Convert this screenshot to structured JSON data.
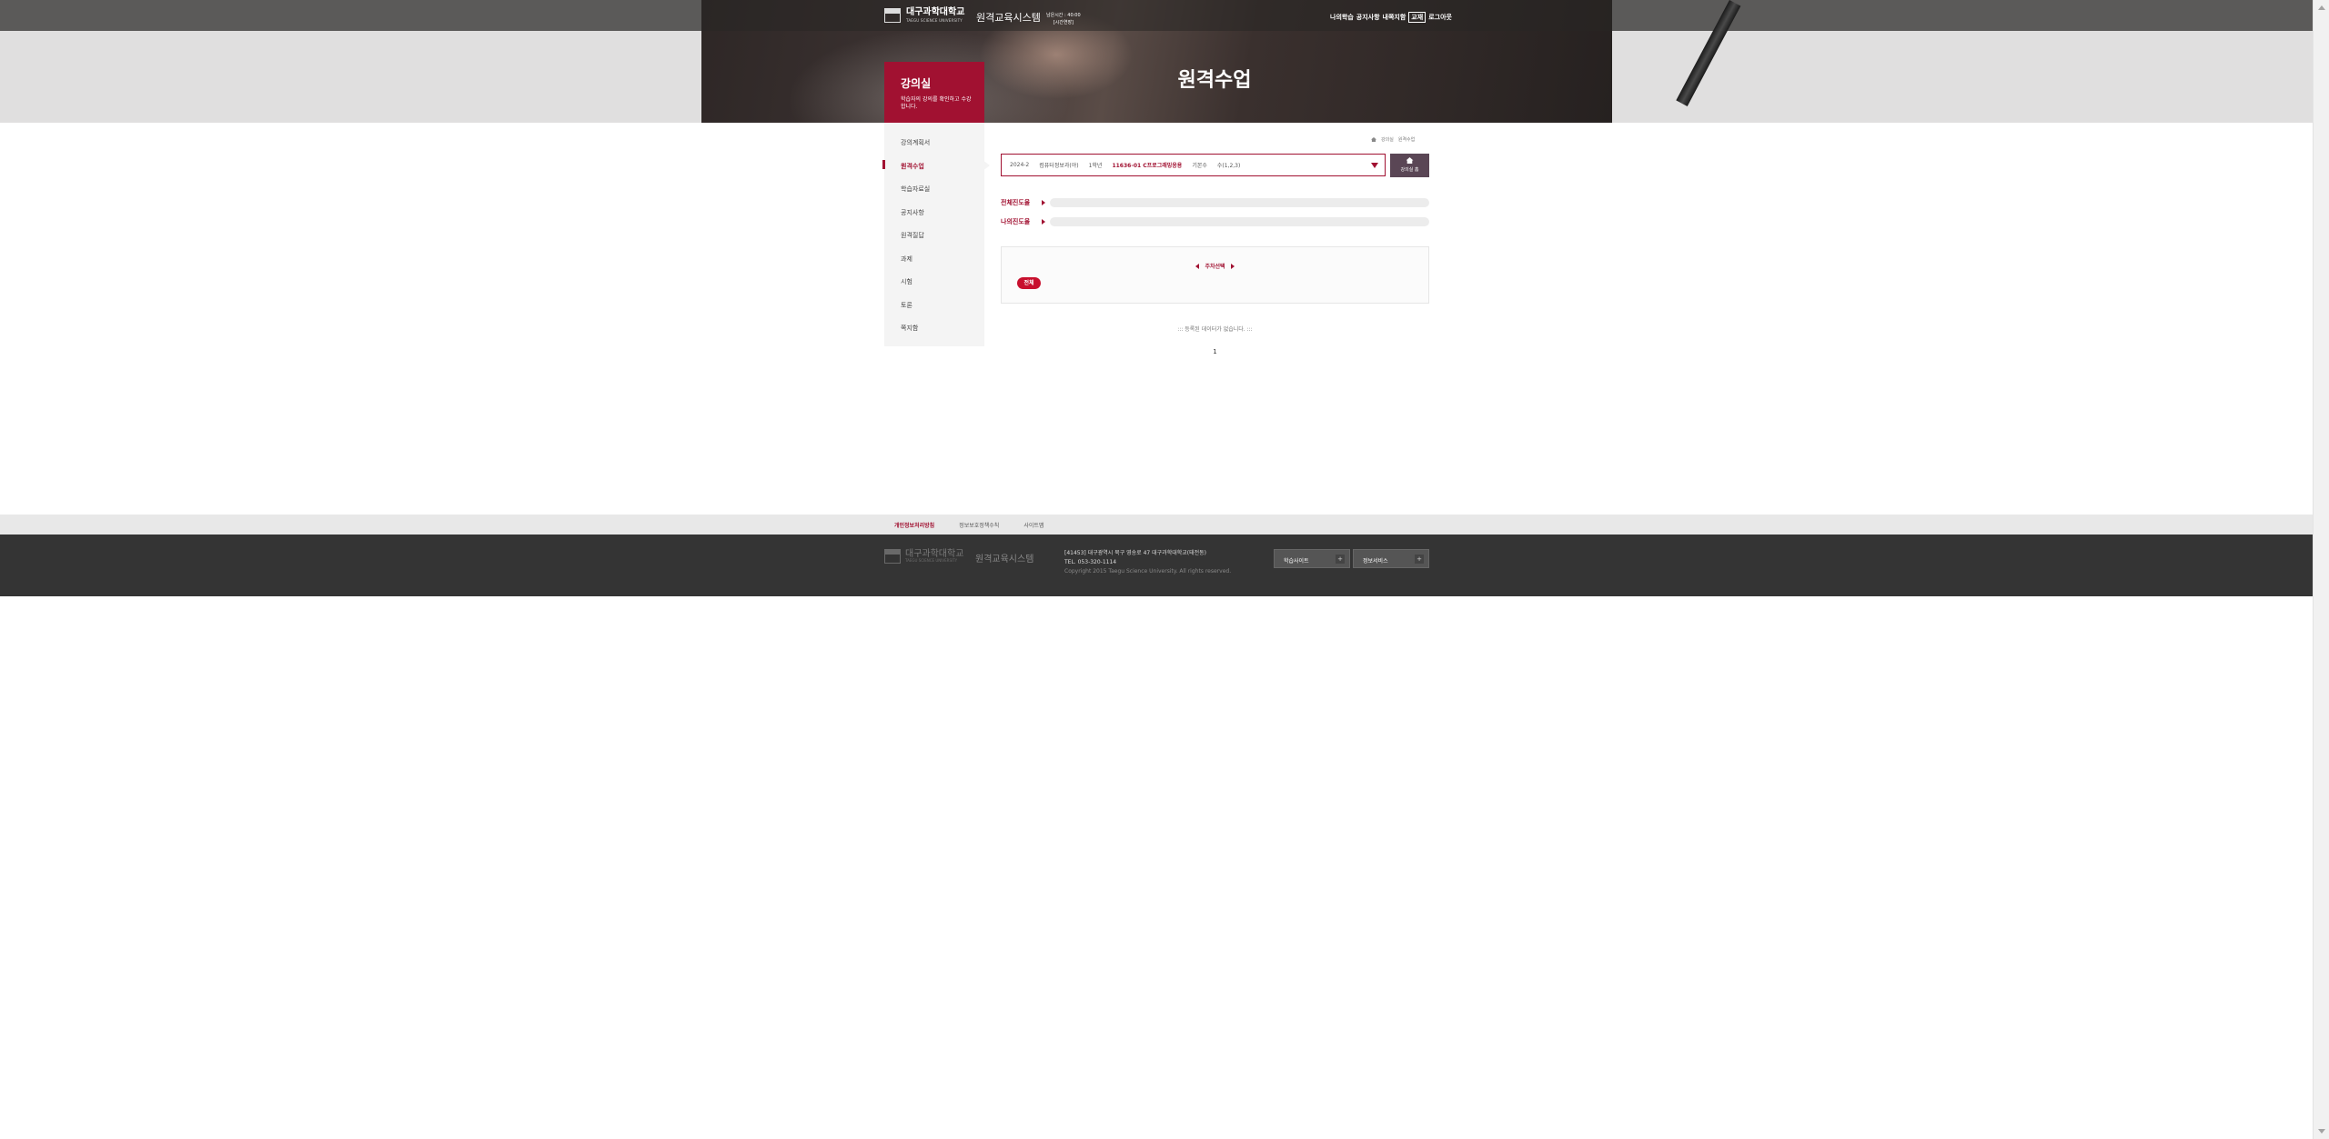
{
  "header": {
    "logo_kr": "대구과학대학교",
    "logo_en": "TAEGU SCIENCE UNIVERSITY",
    "system_title": "원격교육시스템",
    "mini_info_line1": "남은시간 : 40:00",
    "mini_info_line2": "[시간연장]",
    "top_menu": [
      "나의학습",
      "공지사항",
      "내쪽지함",
      "교재",
      "로그아웃"
    ]
  },
  "hero": {
    "box_title": "강의실",
    "box_subtitle": "학습자의 강의를 확인하고 수강합니다.",
    "page_title": "원격수업"
  },
  "sidebar": {
    "items": [
      {
        "label": "강의계획서"
      },
      {
        "label": "원격수업"
      },
      {
        "label": "학습자료실"
      },
      {
        "label": "공지사항"
      },
      {
        "label": "원격질답"
      },
      {
        "label": "과제"
      },
      {
        "label": "시험"
      },
      {
        "label": "토론"
      },
      {
        "label": "쪽지함"
      }
    ]
  },
  "breadcrumb": {
    "items": [
      "강의실",
      "원격수업"
    ]
  },
  "course": {
    "semester": "2024-2",
    "dept": "컴퓨터정보과(야)",
    "grade": "1학년",
    "course_name": "11636-01 C프로그래밍응용",
    "time_label": "기본수",
    "time_value": "수(1,2,3)"
  },
  "lecture_home_label": "강의실 홈",
  "progress": {
    "total_label": "전체진도율",
    "my_label": "나의진도율",
    "total_value": 0,
    "my_value": 0
  },
  "week_panel": {
    "week_select": "주차선택",
    "all_button": "전체"
  },
  "list": {
    "empty_message": "::: 등록된 데이터가 없습니다. :::",
    "page": "1"
  },
  "footer": {
    "links": [
      "개인정보처리방침",
      "정보보호정책수칙",
      "사이트맵"
    ],
    "logo_kr": "대구과학대학교",
    "logo_en": "TAEGU SCIENCE UNIVERSITY",
    "system_title": "원격교육시스템",
    "address": "[41453] 대구광역시 북구 영송로 47 대구과학대학교(태전동)",
    "tel": "TEL. 053-320-1114",
    "copyright": "Copyright 2015 Taegu Science University. All rights reserved.",
    "select1": "학습사이트",
    "select2": "정보서비스"
  },
  "colors": {
    "accent": "#a11131",
    "button": "#c8102e",
    "footer_bg": "#343434"
  }
}
